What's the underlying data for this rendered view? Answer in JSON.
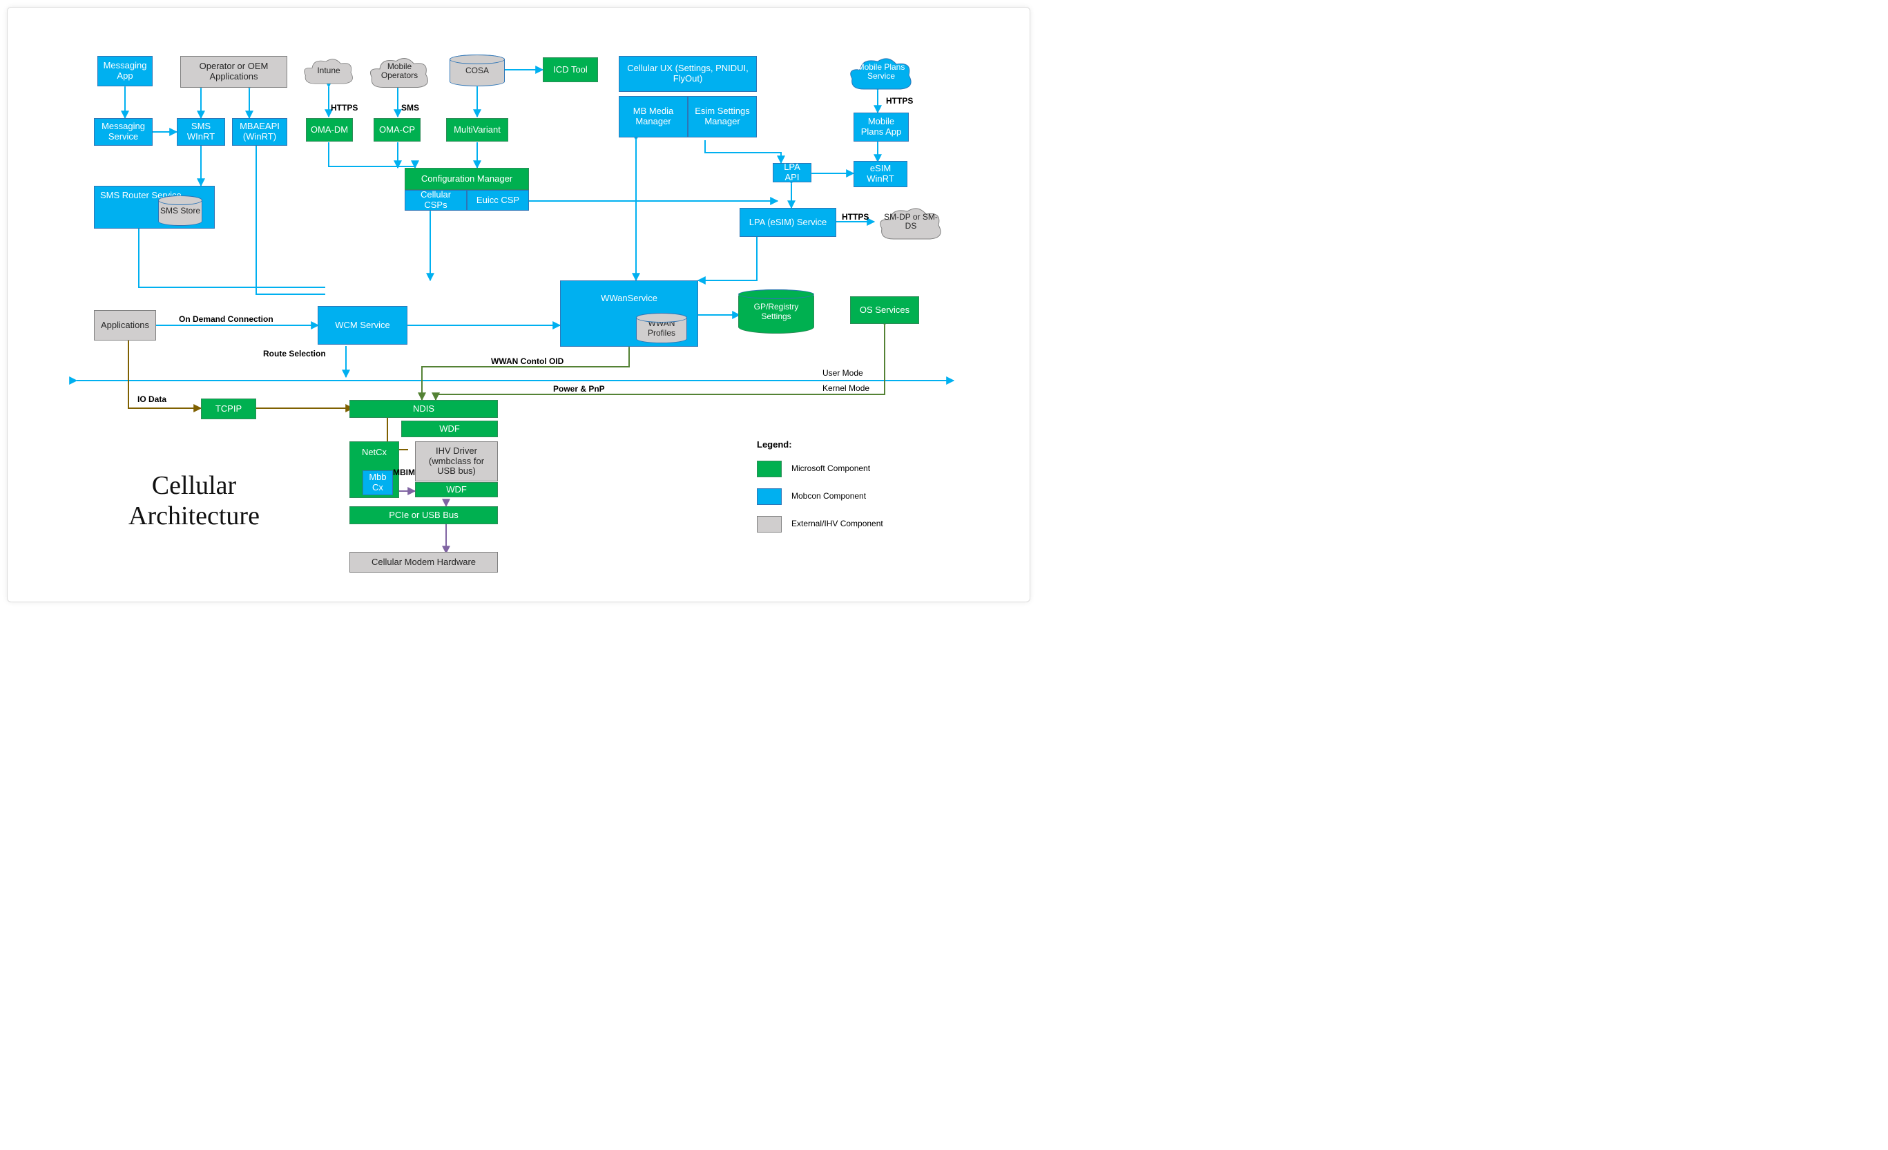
{
  "diagram": {
    "title_line1": "Cellular",
    "title_line2": "Architecture",
    "mode_user": "User Mode",
    "mode_kernel": "Kernel Mode"
  },
  "legend": {
    "title": "Legend:",
    "ms": "Microsoft Component",
    "mobcon": "Mobcon Component",
    "ext": "External/IHV Component"
  },
  "edges": {
    "https_intune": "HTTPS",
    "sms_operators": "SMS",
    "https_mps": "HTTPS",
    "https_lpa": "HTTPS",
    "on_demand": "On Demand Connection",
    "route_sel": "Route Selection",
    "io_data": "IO Data",
    "wwan_oid": "WWAN Contol OID",
    "power_pnp": "Power & PnP",
    "mbim": "MBIM"
  },
  "boxes": {
    "messaging_app": "Messaging App",
    "oem_apps": "Operator or OEM Applications",
    "intune": "Intune",
    "mobile_operators": "Mobile Operators",
    "cosa": "COSA",
    "icd_tool": "ICD Tool",
    "cell_ux": "Cellular UX (Settings, PNIDUI, FlyOut)",
    "mps_cloud": "Mobile Plans Service",
    "messaging_service": "Messaging Service",
    "sms_winrt": "SMS WInRT",
    "mbaeapi": "MBAEAPI (WinRT)",
    "oma_dm": "OMA-DM",
    "oma_cp": "OMA-CP",
    "multivariant": "MultiVariant",
    "mb_media": "MB Media Manager",
    "esim_settings": "Esim Settings Manager",
    "mobile_plans_app": "Mobile Plans App",
    "lpa_api": "LPA API",
    "esim_winrt": "eSIM WinRT",
    "sms_router": "SMS Router Service",
    "sms_store": "SMS Store",
    "config_mgr": "Configuration Manager",
    "cellular_csps": "Cellular CSPs",
    "euicc_csp": "Euicc CSP",
    "lpa_service": "LPA (eSIM) Service",
    "smdp": "SM-DP or SM-DS",
    "applications": "Applications",
    "wcm": "WCM Service",
    "wwanservice": "WWanService",
    "wwan_profiles": "WWAN Profiles",
    "gp_registry": "GP/Registry Settings",
    "os_services": "OS Services",
    "tcpip": "TCPIP",
    "ndis": "NDIS",
    "wdf1": "WDF",
    "netcx": "NetCx",
    "mbbcx": "Mbb Cx",
    "ihv_driver": "IHV Driver (wmbclass for USB bus)",
    "wdf2": "WDF",
    "pcie": "PCIe or USB Bus",
    "modem_hw": "Cellular Modem Hardware"
  }
}
